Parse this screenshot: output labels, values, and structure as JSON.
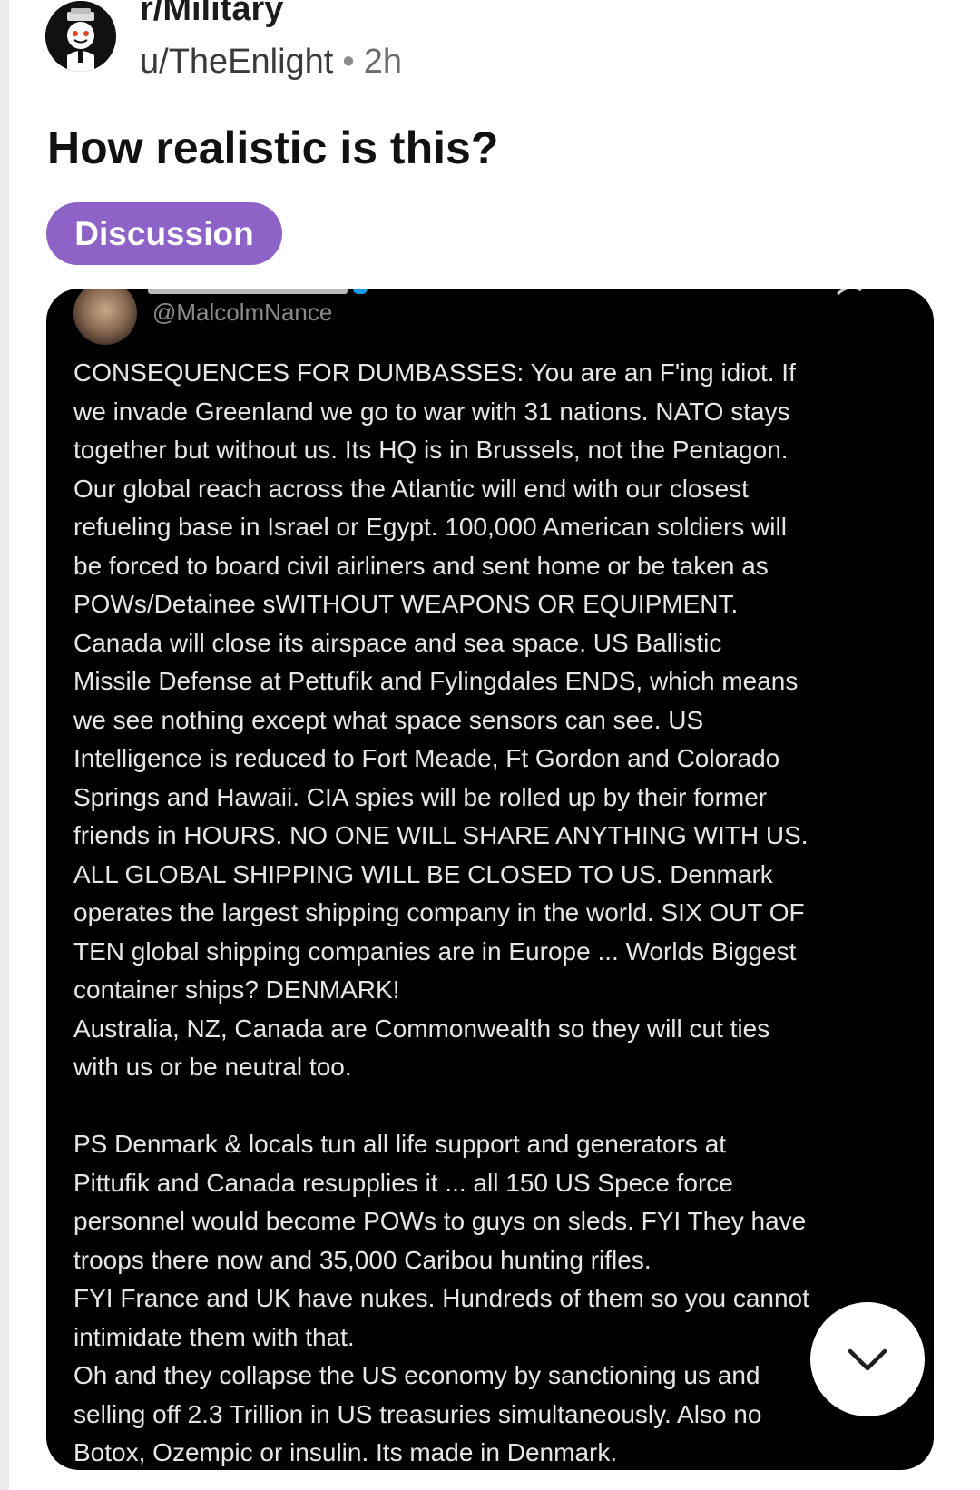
{
  "post": {
    "subreddit": "r/Military",
    "author": "u/TheEnlight",
    "separator": "•",
    "time": "2h",
    "title": "How realistic is this?",
    "flair": "Discussion",
    "flair_color": "#8e63c8"
  },
  "tweet": {
    "handle": "@MalcolmNance",
    "lines": [
      "CONSEQUENCES FOR DUMBASSES:  You are an F'ing idiot.  If",
      "we invade Greenland we go to war with 31 nations.  NATO stays",
      "together but without us.  Its HQ is in Brussels, not the Pentagon.",
      "Our global reach across the Atlantic will end with our closest",
      "refueling base in Israel or Egypt. 100,000 American soldiers will",
      "be forced to board civil airliners and sent home or be taken as",
      "POWs/Detainee sWITHOUT WEAPONS OR EQUIPMENT.",
      "Canada will close its airspace and sea space.  US Ballistic",
      "Missile Defense at Pettufik and Fylingdales ENDS, which means",
      "we see nothing except what space sensors can see.  US",
      "Intelligence is reduced to Fort Meade, Ft Gordon and Colorado",
      "Springs and Hawaii.  CIA spies will be rolled up by their former",
      "friends in HOURS.  NO ONE WILL SHARE ANYTHING WITH US.",
      "ALL GLOBAL SHIPPING WILL BE CLOSED TO US.  Denmark",
      "operates the largest shipping company in the world. SIX OUT OF",
      "TEN global shipping companies are in Europe ... Worlds Biggest",
      "container ships? DENMARK!",
      "Australia, NZ, Canada are Commonwealth so they will cut ties",
      "with us or be neutral too.",
      "",
      "PS Denmark & locals tun all life support and  generators at",
      "Pittufik and Canada resupplies it ... all 150 US Spece force",
      "personnel would become POWs to guys on sleds.  FYI They have",
      "troops there now and 35,000 Caribou hunting rifles.",
      "FYI France and UK have nukes.  Hundreds of them so you cannot",
      "intimidate them with that.",
      "Oh and they collapse the US economy by sanctioning us and",
      "selling off 2.3 Trillion in US treasuries simultaneously.  Also no",
      "Botox, Ozempic or insulin.  Its made in Denmark."
    ]
  },
  "icons": {
    "subreddit_avatar": "snoo-avatar-icon",
    "expand": "chevron-down-icon",
    "tweet_menu": "more-icon"
  }
}
